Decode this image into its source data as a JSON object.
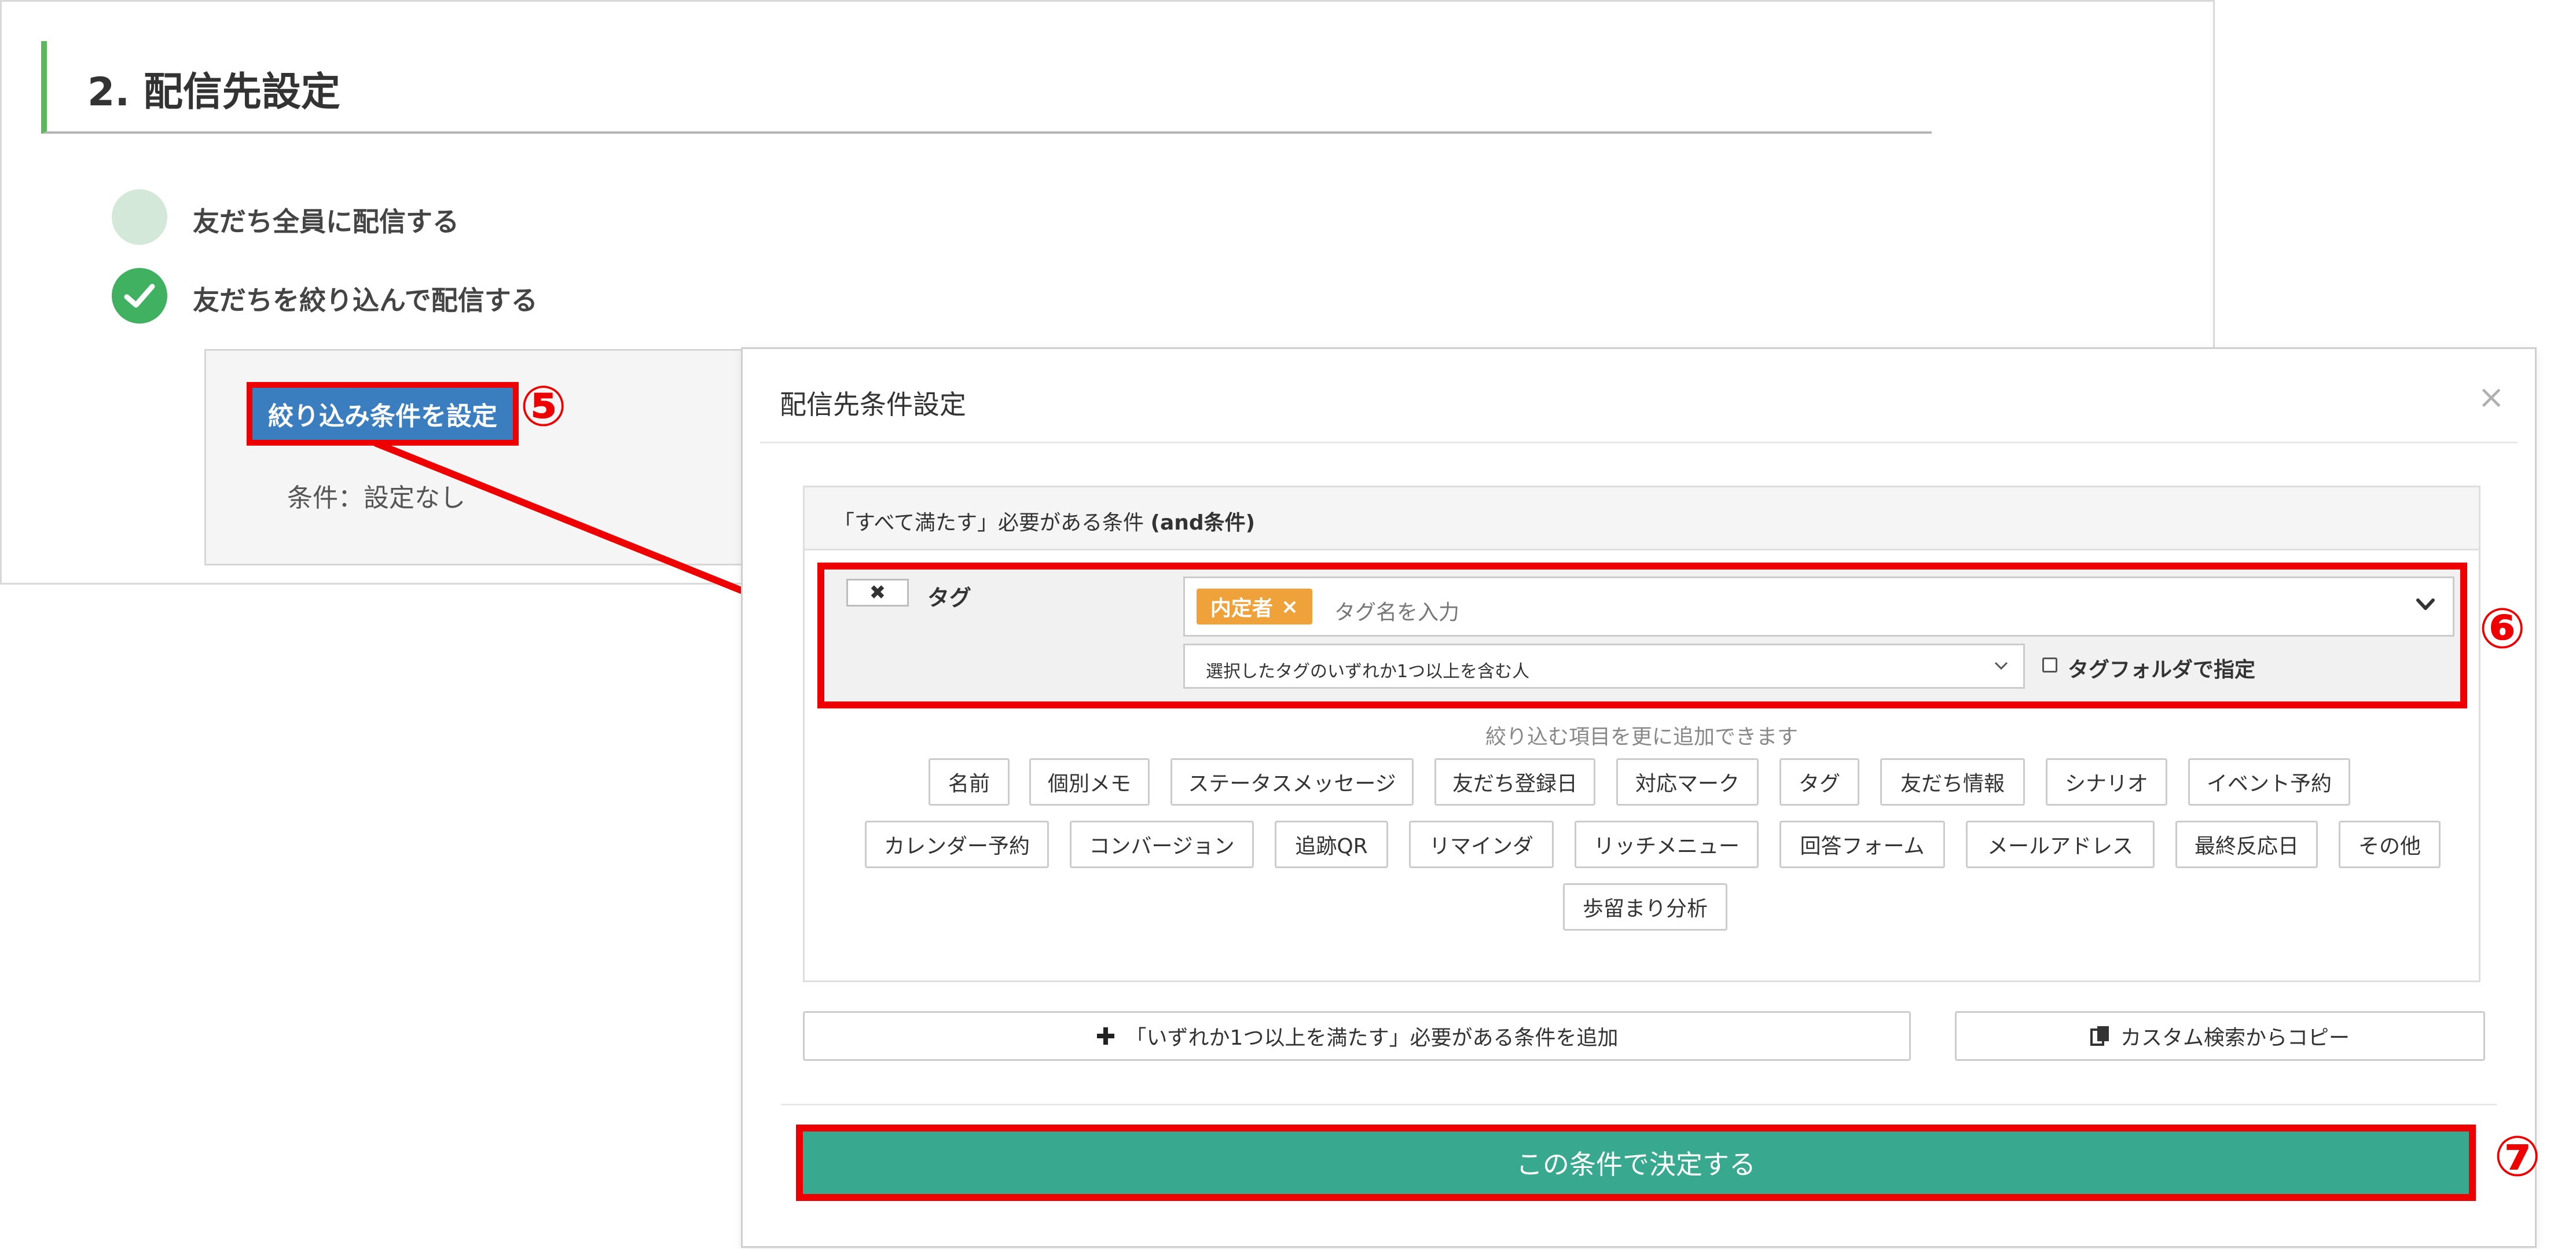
{
  "section": {
    "title": "2. 配信先設定"
  },
  "radio_options": [
    {
      "label": "友だち全員に配信する",
      "checked": false
    },
    {
      "label": "友だちを絞り込んで配信する",
      "checked": true
    }
  ],
  "filter": {
    "button_label": "絞り込み条件を設定",
    "condition_text": "条件：設定なし"
  },
  "steps": {
    "five": "⑤",
    "six": "⑥",
    "seven": "⑦"
  },
  "modal": {
    "title": "配信先条件設定",
    "close": "×",
    "group_title": "「すべて満たす」必要がある条件",
    "group_title_strong": "(and条件)",
    "condition": {
      "remove_icon": "✖",
      "label": "タグ",
      "chip": "内定者",
      "chip_remove": "×",
      "placeholder": "タグ名を入力",
      "match_option": "選択したタグのいずれか1つ以上を含む人",
      "folder_checkbox_label": "タグフォルダで指定",
      "folder_checked": false
    },
    "add_hint": "絞り込む項目を更に追加できます",
    "add_items": [
      "名前",
      "個別メモ",
      "ステータスメッセージ",
      "友だち登録日",
      "対応マーク",
      "タグ",
      "友だち情報",
      "シナリオ",
      "イベント予約",
      "カレンダー予約",
      "コンバージョン",
      "追跡QR",
      "リマインダ",
      "リッチメニュー",
      "回答フォーム",
      "メールアドレス",
      "最終反応日",
      "その他",
      "歩留まり分析"
    ],
    "add_or_group": "「いずれか1つ以上を満たす」必要がある条件を追加",
    "copy_custom": "カスタム検索からコピー",
    "submit": "この条件で決定する"
  },
  "colors": {
    "accent_green": "#3fb160",
    "primary_blue": "#3a7ec0",
    "chip_orange": "#f0a23a",
    "submit_teal": "#38a98e",
    "highlight_red": "#ee0000"
  }
}
